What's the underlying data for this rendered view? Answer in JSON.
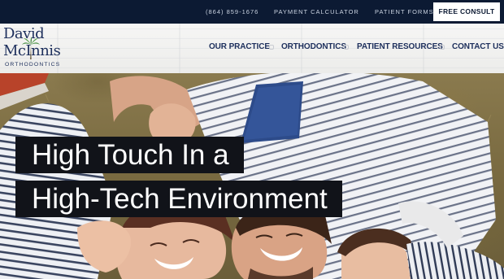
{
  "topbar": {
    "phone": "(864) 859-1676",
    "payment_calculator": "PAYMENT CALCULATOR",
    "patient_forms": "PATIENT FORMS",
    "free_consult": "FREE CONSULT",
    "background_color": "#0c1a33"
  },
  "logo": {
    "line1": "David",
    "line2": "McInnis",
    "line3": "ORTHODONTICS",
    "brand_color": "#1d2f5c",
    "palm_color": "#3e8a3a"
  },
  "nav": {
    "items": [
      {
        "label": "OUR PRACTICE"
      },
      {
        "label": "ORTHODONTICS"
      },
      {
        "label": "PATIENT RESOURCES"
      },
      {
        "label": "CONTACT US"
      }
    ]
  },
  "hero": {
    "headline_line1": "High Touch In a",
    "headline_line2": "High-Tech Environment"
  }
}
